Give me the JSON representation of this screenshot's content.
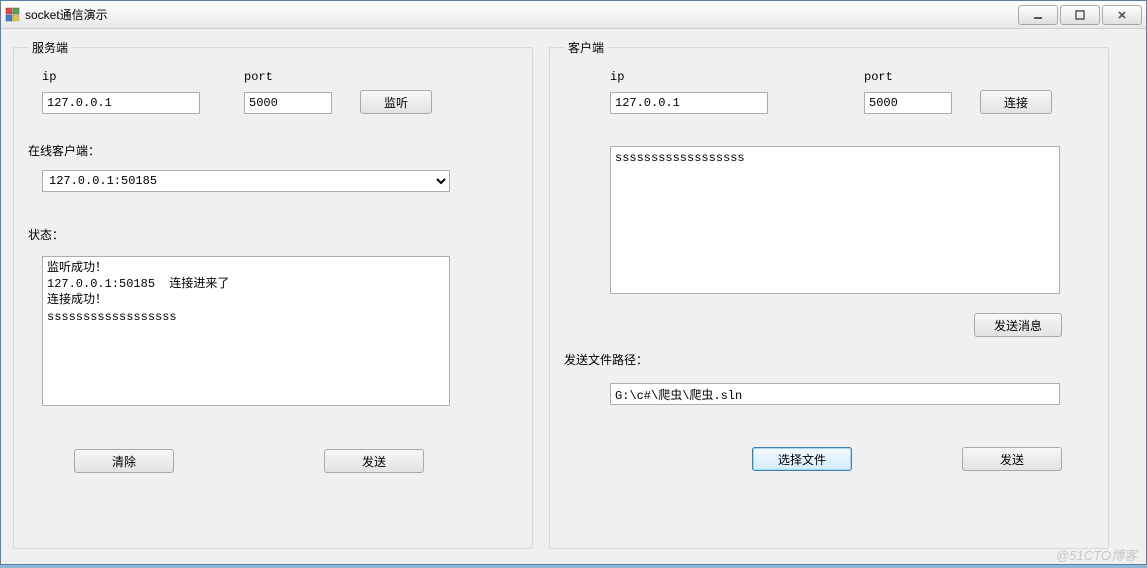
{
  "window": {
    "title": "socket通信演示"
  },
  "server": {
    "legend": "服务端",
    "ip_label": "ip",
    "ip_value": "127.0.0.1",
    "port_label": "port",
    "port_value": "5000",
    "listen_btn": "监听",
    "clients_label": "在线客户端：",
    "client_selected": "127.0.0.1:50185",
    "status_label": "状态：",
    "status_text": "监听成功！\n127.0.0.1:50185  连接进来了\n连接成功！\nssssssssssssssssss",
    "clear_btn": "清除",
    "send_btn": "发送"
  },
  "client": {
    "legend": "客户端",
    "ip_label": "ip",
    "ip_value": "127.0.0.1",
    "port_label": "port",
    "port_value": "5000",
    "connect_btn": "连接",
    "msg_text": "ssssssssssssssssss",
    "send_msg_btn": "发送消息",
    "file_path_label": "发送文件路径：",
    "file_path_value": "G:\\c#\\爬虫\\爬虫.sln",
    "choose_file_btn": "选择文件",
    "send_btn": "发送"
  },
  "watermark": "@51CTO博客"
}
